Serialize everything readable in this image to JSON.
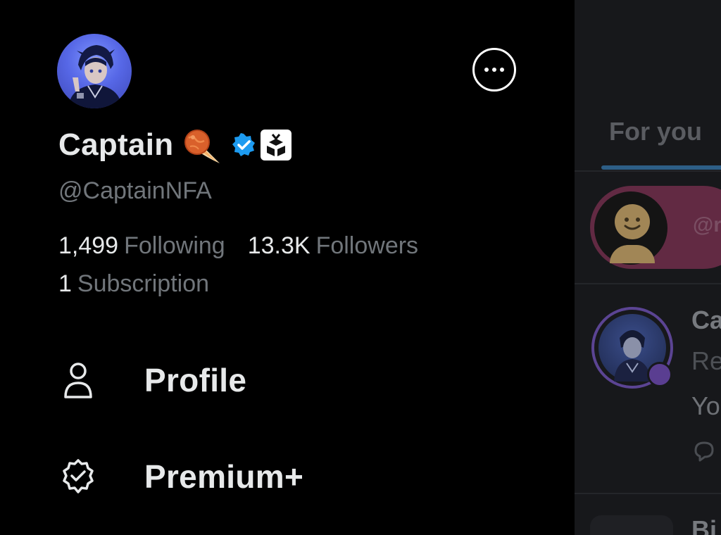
{
  "profile": {
    "display_name": "Captain",
    "handle": "@CaptainNFA",
    "emoji_badge": "meteor-emoji-icon",
    "verified_badge": "verified-badge-icon",
    "affiliate_badge": "gift-box-icon",
    "verified_color": "#1d9bf0"
  },
  "stats": {
    "following_count": "1,499",
    "following_label": "Following",
    "followers_count": "13.3K",
    "followers_label": "Followers",
    "subscription_count": "1",
    "subscription_label": "Subscription"
  },
  "header": {
    "more_icon": "more-horizontal-icon"
  },
  "menu": {
    "items": [
      {
        "label": "Profile",
        "icon": "person-icon"
      },
      {
        "label": "Premium+",
        "icon": "premium-badge-icon"
      }
    ]
  },
  "timeline": {
    "tab_label": "For you",
    "space_handle": "@r",
    "tweet_name": "Ca",
    "tweet_subtitle": "Re",
    "tweet_body": "Yo",
    "next_name": "Bi"
  },
  "colors": {
    "background": "#000000",
    "primary_text": "#e7e9ea",
    "secondary_text": "#71767b",
    "accent": "#1d9bf0"
  }
}
